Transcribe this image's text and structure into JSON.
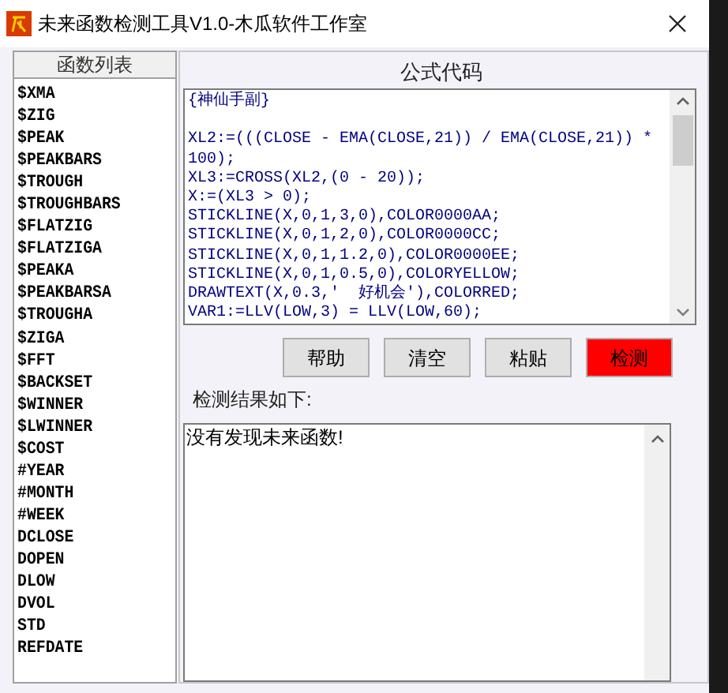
{
  "window": {
    "title": "未来函数检测工具V1.0-木瓜软件工作室"
  },
  "function_list": {
    "header": "函数列表",
    "items": [
      "$XMA",
      "$ZIG",
      "$PEAK",
      "$PEAKBARS",
      "$TROUGH",
      "$TROUGHBARS",
      "$FLATZIG",
      "$FLATZIGA",
      "$PEAKA",
      "$PEAKBARSA",
      "$TROUGHA",
      "$ZIGA",
      "$FFT",
      "$BACKSET",
      "$WINNER",
      "$LWINNER",
      "$COST",
      "#YEAR",
      "#MONTH",
      "#WEEK",
      "DCLOSE",
      "DOPEN",
      "DLOW",
      "DVOL",
      "STD",
      "REFDATE"
    ]
  },
  "code_panel": {
    "header": "公式代码",
    "lines": [
      "{神仙手副}",
      {
        "text": "XL2:=(((CLOSE - EMA(CLOSE,21)) / EMA(CLOSE,21)) *",
        "blank_line_before": true
      },
      "100);",
      "XL3:=CROSS(XL2,(0 - 20));",
      "X:=(XL3 > 0);",
      "STICKLINE(X,0,1,3,0),COLOR0000AA;",
      "STICKLINE(X,0,1,2,0),COLOR0000CC;",
      "STICKLINE(X,0,1,1.2,0),COLOR0000EE;",
      "STICKLINE(X,0,1,0.5,0),COLORYELLOW;",
      "DRAWTEXT(X,0.3,'  好机会'),COLORRED;",
      "VAR1:=LLV(LOW,3) = LLV(LOW,60);"
    ]
  },
  "buttons": [
    {
      "label": "帮助",
      "kind": "normal"
    },
    {
      "label": "清空",
      "kind": "normal"
    },
    {
      "label": "粘贴",
      "kind": "normal"
    },
    {
      "label": "检测",
      "kind": "primary"
    }
  ],
  "result": {
    "label": "检测结果如下:",
    "text": "没有发现未来函数!"
  }
}
